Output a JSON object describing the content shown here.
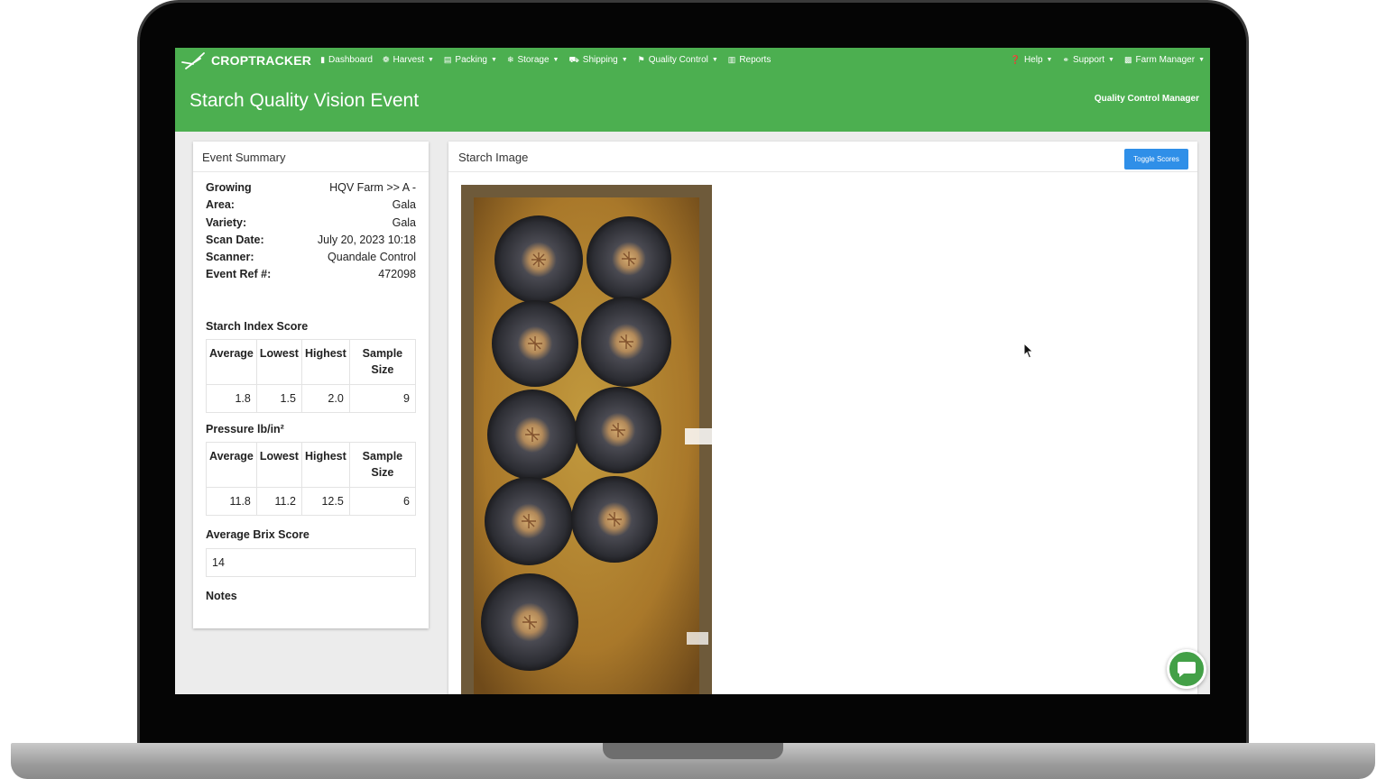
{
  "nav": {
    "brand": "CROPTRACKER",
    "items": [
      {
        "label": "Dashboard",
        "icon": "bookmark-icon",
        "caret": false
      },
      {
        "label": "Harvest",
        "icon": "harvest-icon",
        "caret": true
      },
      {
        "label": "Packing",
        "icon": "packing-icon",
        "caret": true
      },
      {
        "label": "Storage",
        "icon": "snowflake-icon",
        "caret": true
      },
      {
        "label": "Shipping",
        "icon": "truck-icon",
        "caret": true
      },
      {
        "label": "Quality Control",
        "icon": "flag-icon",
        "caret": true
      },
      {
        "label": "Reports",
        "icon": "bar-chart-icon",
        "caret": false
      }
    ],
    "right_items": [
      {
        "label": "Help",
        "icon": "question-icon"
      },
      {
        "label": "Support",
        "icon": "headset-icon"
      },
      {
        "label": "Farm Manager",
        "icon": "briefcase-icon"
      }
    ]
  },
  "header": {
    "title": "Starch Quality Vision Event",
    "role": "Quality Control Manager"
  },
  "summary": {
    "title": "Event Summary",
    "growing_label": "Growing",
    "growing_value": "HQV Farm >> A -",
    "details": [
      {
        "key": "Area:",
        "value": "Gala"
      },
      {
        "key": "Variety:",
        "value": "Gala"
      },
      {
        "key": "Scan Date:",
        "value": "July 20, 2023 10:18"
      },
      {
        "key": "Scanner:",
        "value": "Quandale Control"
      },
      {
        "key": "Event Ref #:",
        "value": "472098"
      }
    ],
    "starch": {
      "title": "Starch Index Score",
      "headers": [
        "Average",
        "Lowest",
        "Highest",
        "Sample Size"
      ],
      "values": [
        "1.8",
        "1.5",
        "2.0",
        "9"
      ]
    },
    "pressure": {
      "title": "Pressure lb/in²",
      "headers": [
        "Average",
        "Lowest",
        "Highest",
        "Sample Size"
      ],
      "values": [
        "11.8",
        "11.2",
        "12.5",
        "6"
      ]
    },
    "brix": {
      "title": "Average Brix Score",
      "value": "14"
    },
    "notes_label": "Notes"
  },
  "image_panel": {
    "title": "Starch Image",
    "toggle_label": "Toggle Scores"
  },
  "colors": {
    "brand_green": "#4caf50",
    "button_blue": "#2f8fe8",
    "chat_green": "#43a047"
  }
}
